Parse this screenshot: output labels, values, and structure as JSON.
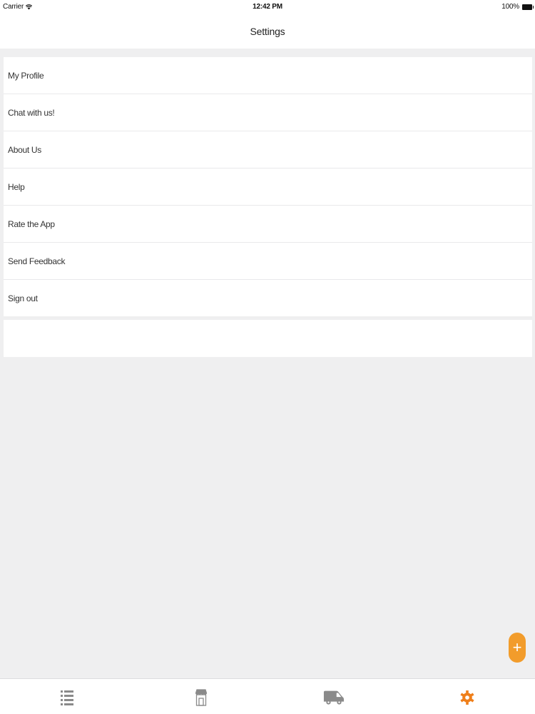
{
  "status_bar": {
    "carrier": "Carrier",
    "time": "12:42 PM",
    "battery": "100%"
  },
  "nav": {
    "title": "Settings"
  },
  "settings_items": [
    "My Profile",
    "Chat with us!",
    "About Us",
    "Help",
    "Rate the App",
    "Send Feedback",
    "Sign out"
  ],
  "fab": {
    "symbol": "+",
    "color": "#f29c2b"
  },
  "tab_bar": {
    "tabs": [
      {
        "icon": "list-icon",
        "active": false
      },
      {
        "icon": "store-icon",
        "active": false
      },
      {
        "icon": "delivery-van-icon",
        "active": false
      },
      {
        "icon": "gear-icon",
        "active": true
      }
    ],
    "active_color": "#ef7f1a",
    "inactive_color": "#8a8a8a"
  }
}
